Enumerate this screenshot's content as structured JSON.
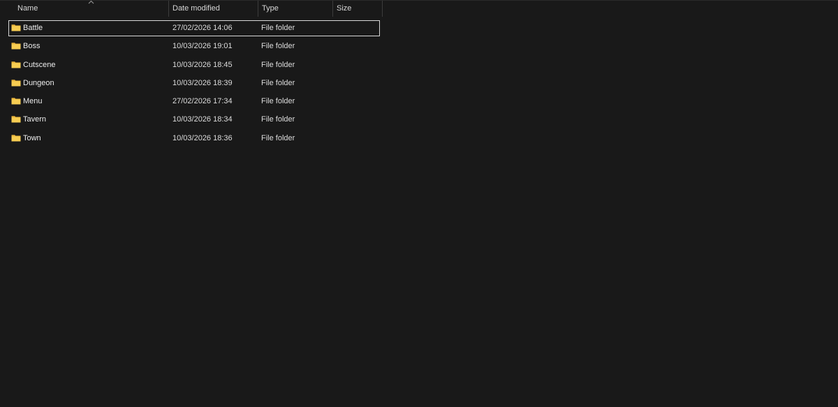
{
  "columns": {
    "name": "Name",
    "date": "Date modified",
    "type": "Type",
    "size": "Size"
  },
  "sort": {
    "column": "Name",
    "direction": "ascending",
    "icon": "chevron-up-icon"
  },
  "colors": {
    "background": "#191919",
    "folder": "#f4c542",
    "selection_outline": "#d8d8d8"
  },
  "rows": [
    {
      "name": "Battle",
      "date": "27/02/2026 14:06",
      "type": "File folder",
      "size": "",
      "icon": "folder-icon",
      "selected": true
    },
    {
      "name": "Boss",
      "date": "10/03/2026 19:01",
      "type": "File folder",
      "size": "",
      "icon": "folder-icon"
    },
    {
      "name": "Cutscene",
      "date": "10/03/2026 18:45",
      "type": "File folder",
      "size": "",
      "icon": "folder-icon"
    },
    {
      "name": "Dungeon",
      "date": "10/03/2026 18:39",
      "type": "File folder",
      "size": "",
      "icon": "folder-icon"
    },
    {
      "name": "Menu",
      "date": "27/02/2026 17:34",
      "type": "File folder",
      "size": "",
      "icon": "folder-icon"
    },
    {
      "name": "Tavern",
      "date": "10/03/2026 18:34",
      "type": "File folder",
      "size": "",
      "icon": "folder-icon"
    },
    {
      "name": "Town",
      "date": "10/03/2026 18:36",
      "type": "File folder",
      "size": "",
      "icon": "folder-icon"
    }
  ]
}
